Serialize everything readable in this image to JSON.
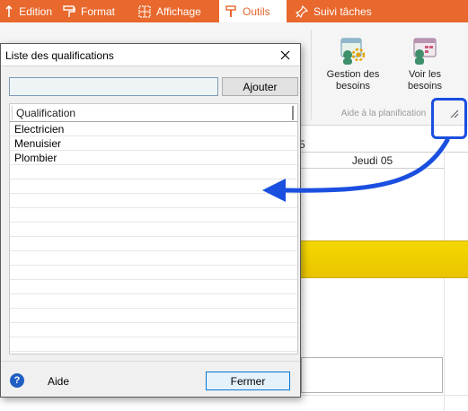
{
  "tabs": [
    {
      "label": "Edition",
      "icon": "edition-icon"
    },
    {
      "label": "Format",
      "icon": "format-paint-roller-icon"
    },
    {
      "label": "Affichage",
      "icon": "grid-view-icon"
    },
    {
      "label": "Outils",
      "icon": "tools-hammer-icon",
      "active": true
    },
    {
      "label": "Suivi tâches",
      "icon": "pin-icon"
    }
  ],
  "ribbon": {
    "buttons": [
      {
        "label_line1": "Gestion des",
        "label_line2": "besoins",
        "icon": "manage-needs-icon"
      },
      {
        "label_line1": "Voir les",
        "label_line2": "besoins",
        "icon": "view-needs-icon"
      }
    ],
    "group_label": "Aide à la planification",
    "launcher_icon": "dialog-launcher-icon"
  },
  "planning": {
    "date_fragment": "5",
    "day_header": "Jeudi 05"
  },
  "dialog": {
    "title": "Liste des qualifications",
    "input_value": "",
    "add_button": "Ajouter",
    "column_header": "Qualification",
    "items": [
      "Electricien",
      "Menuisier",
      "Plombier"
    ],
    "help_icon_glyph": "?",
    "help_label": "Aide",
    "close_button": "Fermer"
  },
  "colors": {
    "ribbon_orange": "#e8682d",
    "highlight_blue": "#1a4fe0",
    "bar_yellow": "#f4d800"
  }
}
